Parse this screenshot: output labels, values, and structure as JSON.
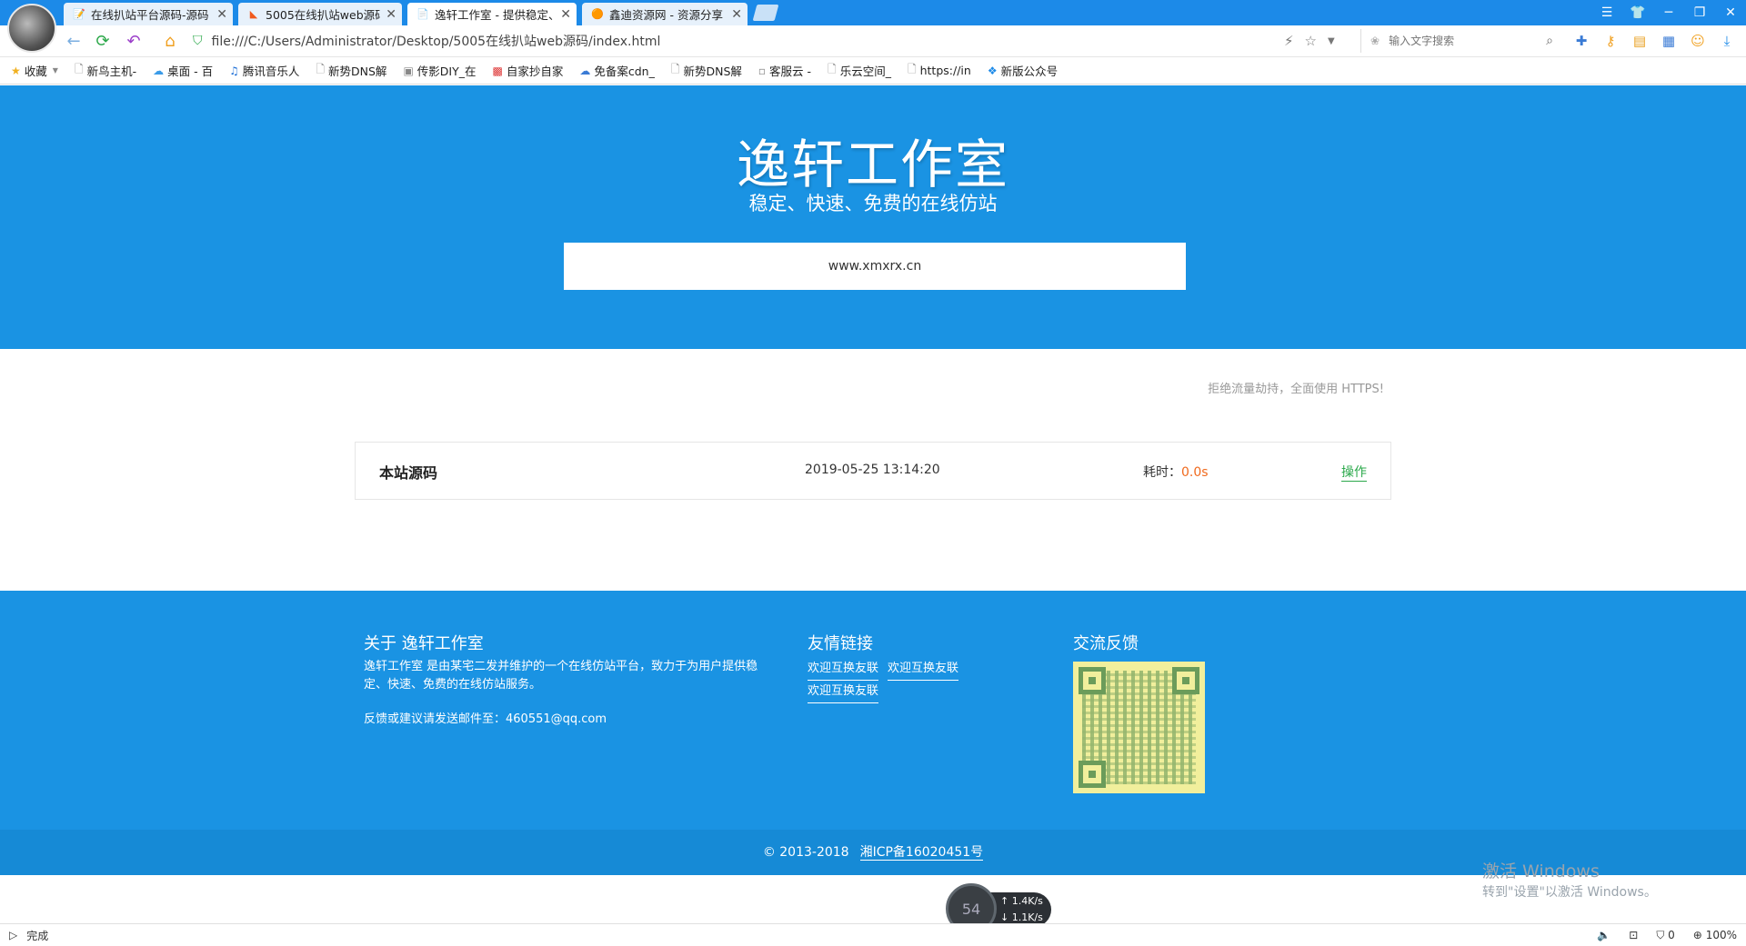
{
  "tabs": [
    {
      "title": "在线扒站平台源码-源码",
      "icon": "📝"
    },
    {
      "title": "5005在线扒站web源码",
      "icon": "◣"
    },
    {
      "title": "逸轩工作室 - 提供稳定、",
      "icon": "📄"
    },
    {
      "title": "鑫迪资源网 - 资源分享",
      "icon": "🟠"
    }
  ],
  "address": {
    "url": "file:///C:/Users/Administrator/Desktop/5005在线扒站web源码/index.html",
    "search_placeholder": "输入文字搜索"
  },
  "bookmarks": [
    "收藏",
    "新鸟主机-",
    "桌面 - 百",
    "腾讯音乐人",
    "新势DNS解",
    "传影DIY_在",
    "自家抄自家",
    "免备案cdn_",
    "新势DNS解",
    "客服云 -",
    "乐云空间_",
    "https://in",
    "新版公众号"
  ],
  "hero": {
    "title": "逸轩工作室",
    "subtitle": "稳定、快速、免费的在线仿站",
    "url_value": "www.xmxrx.cn"
  },
  "notice": "拒绝流量劫持，全面使用 HTTPS!",
  "result": {
    "name": "本站源码",
    "time": "2019-05-25 13:14:20",
    "cost_label": "耗时：",
    "cost_value": "0.0s",
    "action": "操作"
  },
  "footer": {
    "about_title": "关于 逸轩工作室",
    "about_text": "逸轩工作室 是由某宅二发并维护的一个在线仿站平台，致力于为用户提供稳定、快速、免费的在线仿站服务。",
    "about_mail": "反馈或建议请发送邮件至：460551@qq.com",
    "links_title": "友情链接",
    "links": [
      "欢迎互换友联",
      "欢迎互换友联",
      "欢迎互换友联"
    ],
    "feedback_title": "交流反馈"
  },
  "copyright": {
    "text": "© 2013-2018",
    "icp": "湘ICP备16020451号"
  },
  "activation": {
    "line1": "激活 Windows",
    "line2": "转到\"设置\"以激活 Windows。"
  },
  "speed": {
    "center": "54",
    "up": "1.4K/s",
    "down": "1.1K/s"
  },
  "status": {
    "text": "完成",
    "count": "0",
    "zoom": "100%"
  }
}
